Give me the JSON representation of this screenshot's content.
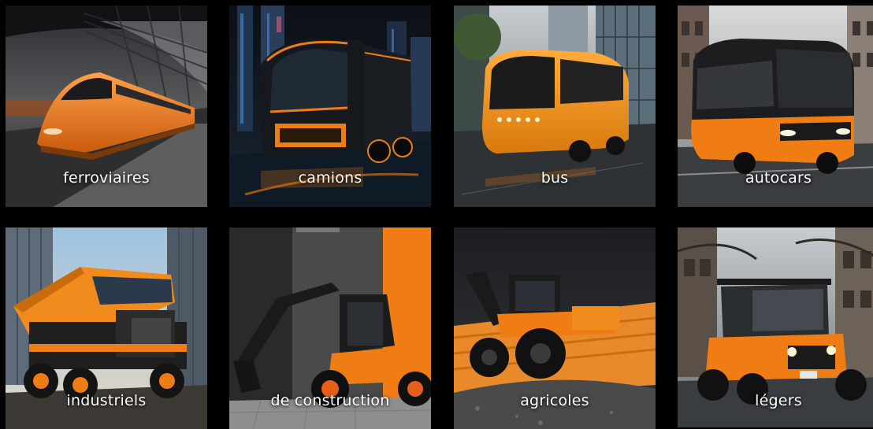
{
  "tiles": [
    {
      "label": "ferroviaires",
      "icon": "train-image"
    },
    {
      "label": "camions",
      "icon": "truck-image"
    },
    {
      "label": "bus",
      "icon": "bus-image"
    },
    {
      "label": "autocars",
      "icon": "coach-image"
    },
    {
      "label": "industriels",
      "icon": "dump-truck-image"
    },
    {
      "label": "de construction",
      "icon": "excavator-image"
    },
    {
      "label": "agricoles",
      "icon": "tractor-image"
    },
    {
      "label": "légers",
      "icon": "utility-vehicle-image"
    }
  ],
  "colors": {
    "background": "#000000",
    "accent": "#f07d14",
    "label": "#ffffff"
  }
}
